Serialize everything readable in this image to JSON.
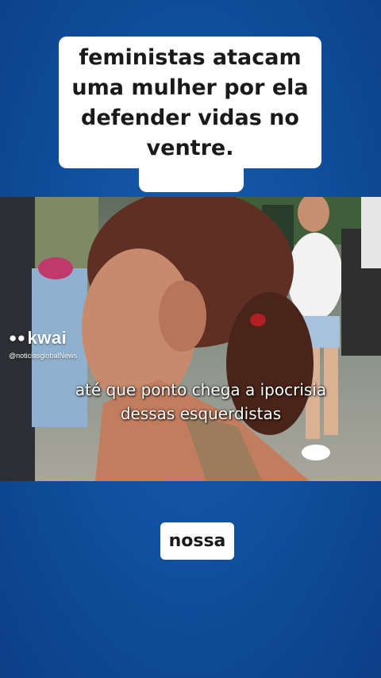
{
  "overlay": {
    "title_text": "feministas atacam uma mulher por ela defender vidas no ventre.",
    "bottom_caption": "nossa"
  },
  "video": {
    "watermark_logo": "kwai",
    "watermark_handle": "@noticiasglobalNews",
    "subtitle": "até que ponto chega a ipocrisia dessas esquerdistas"
  }
}
